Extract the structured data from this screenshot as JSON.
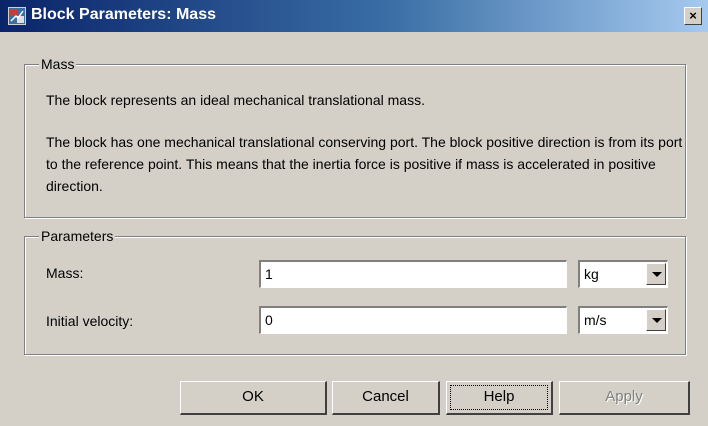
{
  "window": {
    "title": "Block Parameters: Mass",
    "close_symbol": "×"
  },
  "description_group": {
    "legend": "Mass",
    "line1": "The block represents an ideal mechanical translational mass.",
    "line2": "The block has one mechanical translational conserving port. The block positive direction is from its port to the reference point. This means that the inertia force is positive if mass is accelerated in positive direction."
  },
  "parameters_group": {
    "legend": "Parameters",
    "rows": [
      {
        "label": "Mass:",
        "value": "1",
        "unit": "kg"
      },
      {
        "label": "Initial velocity:",
        "value": "0",
        "unit": "m/s"
      }
    ]
  },
  "buttons": {
    "ok": "OK",
    "cancel": "Cancel",
    "help": "Help",
    "apply": "Apply"
  },
  "icons": {
    "title_icon": "simulink-block-icon",
    "dropdown_icon": "chevron-down-icon"
  }
}
